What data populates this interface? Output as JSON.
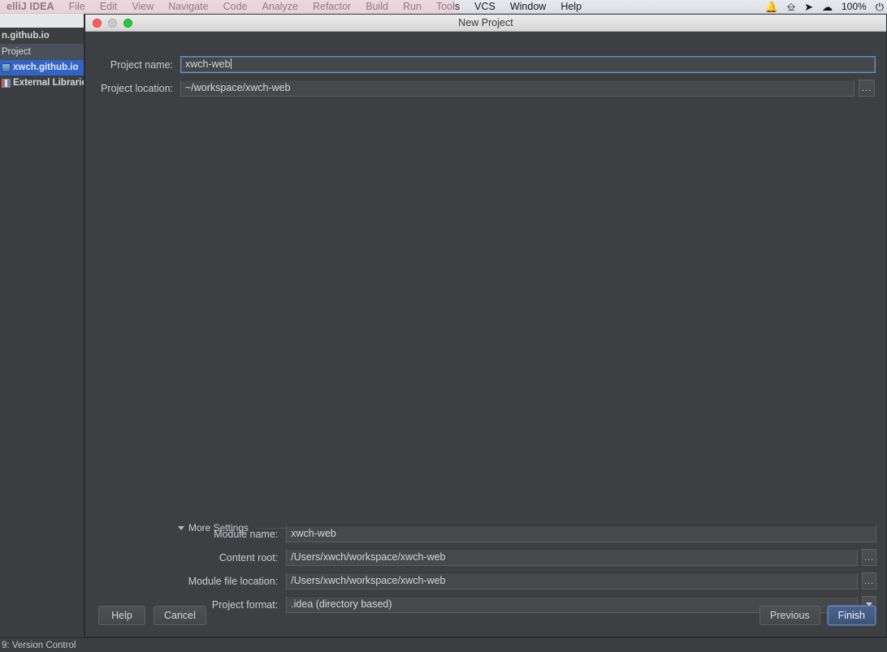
{
  "menubar": {
    "app": "elliJ IDEA",
    "items": [
      "File",
      "Edit",
      "View",
      "Navigate",
      "Code",
      "Analyze",
      "Refactor",
      "Build",
      "Run",
      "Tools",
      "VCS",
      "Window",
      "Help"
    ],
    "right": {
      "notification_icon": "bell-icon",
      "screenshare_icon": "screen-share-icon",
      "telegram_icon": "send-icon",
      "wifi_icon": "wifi-icon",
      "battery_percent": "100%",
      "battery_icon": "battery-charging-icon"
    }
  },
  "sidebar": {
    "breadcrumb": "n.github.io",
    "toolwindow_title": "Project",
    "tree": [
      {
        "label": "xwch.github.io",
        "icon": "module-icon",
        "selected": true
      },
      {
        "label": "External Librarie",
        "icon": "library-icon",
        "selected": false
      }
    ]
  },
  "statusbar": {
    "item": "9: Version Control"
  },
  "dialog": {
    "title": "New Project",
    "window_controls": {
      "close": "close-traffic-light",
      "minimize": "minimize-traffic-light",
      "zoom": "zoom-traffic-light"
    },
    "fields": {
      "project_name": {
        "label": "Project name:",
        "value": "xwch-web",
        "focused": true
      },
      "project_location": {
        "label": "Project location:",
        "value": "~/workspace/xwch-web",
        "browse": "..."
      }
    },
    "more_settings": {
      "label": "More Settings",
      "expanded": true,
      "rows": [
        {
          "label": "Module name:",
          "value": "xwch-web",
          "control": "text"
        },
        {
          "label": "Content root:",
          "value": "/Users/xwch/workspace/xwch-web",
          "control": "text-browse",
          "browse": "..."
        },
        {
          "label": "Module file location:",
          "value": "/Users/xwch/workspace/xwch-web",
          "control": "text-browse",
          "browse": "..."
        },
        {
          "label": "Project format:",
          "value": ".idea (directory based)",
          "control": "dropdown"
        }
      ]
    },
    "buttons": {
      "help": "Help",
      "cancel": "Cancel",
      "previous": "Previous",
      "finish": "Finish"
    }
  },
  "colors": {
    "dialog_bg": "#3c4043",
    "field_bg": "#45494c",
    "accent_selection": "#2f65ca",
    "default_button": "#41587f",
    "focus_border": "#6b8fbd"
  }
}
